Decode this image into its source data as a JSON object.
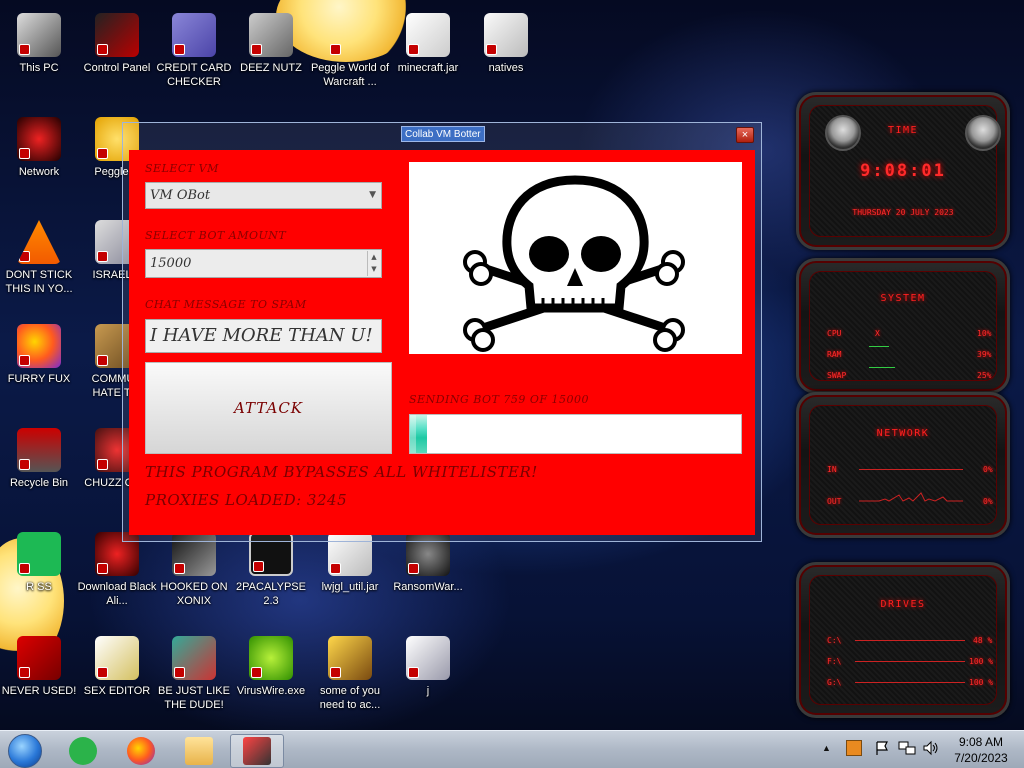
{
  "desktop": {
    "icons": [
      {
        "label": "This PC"
      },
      {
        "label": "Control Panel"
      },
      {
        "label": "CREDIT CARD CHECKER"
      },
      {
        "label": "DEEZ NUTZ"
      },
      {
        "label": "Peggle World of Warcraft ..."
      },
      {
        "label": "minecraft.jar"
      },
      {
        "label": "natives"
      },
      {
        "label": "Network"
      },
      {
        "label": "Peggle D"
      },
      {
        "label": "DONT STICK THIS IN YO..."
      },
      {
        "label": "ISRAEL S"
      },
      {
        "label": "FURRY FUX"
      },
      {
        "label": "COMMUN HATE THI"
      },
      {
        "label": "Recycle Bin"
      },
      {
        "label": "CHUZZ CUM"
      },
      {
        "label": "R SS"
      },
      {
        "label": "Download Black Ali..."
      },
      {
        "label": "HOOKED ON XONIX"
      },
      {
        "label": "2PACALYPSE 2.3"
      },
      {
        "label": "lwjgl_util.jar"
      },
      {
        "label": "RansomWar..."
      },
      {
        "label": "NEVER USED!"
      },
      {
        "label": "SEX EDITOR"
      },
      {
        "label": "BE JUST LIKE THE DUDE!"
      },
      {
        "label": "VirusWire.exe"
      },
      {
        "label": "some of you need to ac..."
      },
      {
        "label": "j"
      }
    ]
  },
  "app": {
    "title": "Collab VM Botter",
    "close": "×",
    "select_vm_label": "SELECT VM",
    "select_vm_value": "VM OBot",
    "select_arrow": "▼",
    "bot_amount_label": "SELECT BOT AMOUNT",
    "bot_amount_value": "15000",
    "spin_up": "▲",
    "spin_down": "▼",
    "chat_label": "CHAT MESSAGE TO SPAM",
    "chat_value": "I HAVE MORE THAN U!",
    "attack_label": "ATTACK",
    "progress_label": "SENDING BOT 759 OF 15000",
    "progress_fraction": 0.05,
    "bypass_text": "THIS PROGRAM BYPASSES ALL WHITELISTER!",
    "proxies_text": "PROXIES LOADED: 3245"
  },
  "widgets": {
    "time": {
      "title": "TIME",
      "clock": "9:08:01",
      "date": "THURSDAY 20 JULY 2023"
    },
    "system": {
      "title": "SYSTEM",
      "rows": [
        {
          "label": "CPU",
          "marker": "X",
          "value": "10%",
          "level": 0.1
        },
        {
          "label": "RAM",
          "value": "39%",
          "level": 0.39
        },
        {
          "label": "SWAP",
          "value": "25%",
          "level": 0.25
        }
      ]
    },
    "network": {
      "title": "NETWORK",
      "rows": [
        {
          "label": "IN",
          "value": "0%"
        },
        {
          "label": "OUT",
          "value": "0%"
        }
      ]
    },
    "drives": {
      "title": "DRIVES",
      "rows": [
        {
          "label": "C:\\",
          "value": "48 %"
        },
        {
          "label": "F:\\",
          "value": "100 %"
        },
        {
          "label": "G:\\",
          "value": "100 %"
        }
      ]
    }
  },
  "taskbar": {
    "tray_chevron": "▲",
    "time": "9:08 AM",
    "date": "7/20/2023"
  }
}
